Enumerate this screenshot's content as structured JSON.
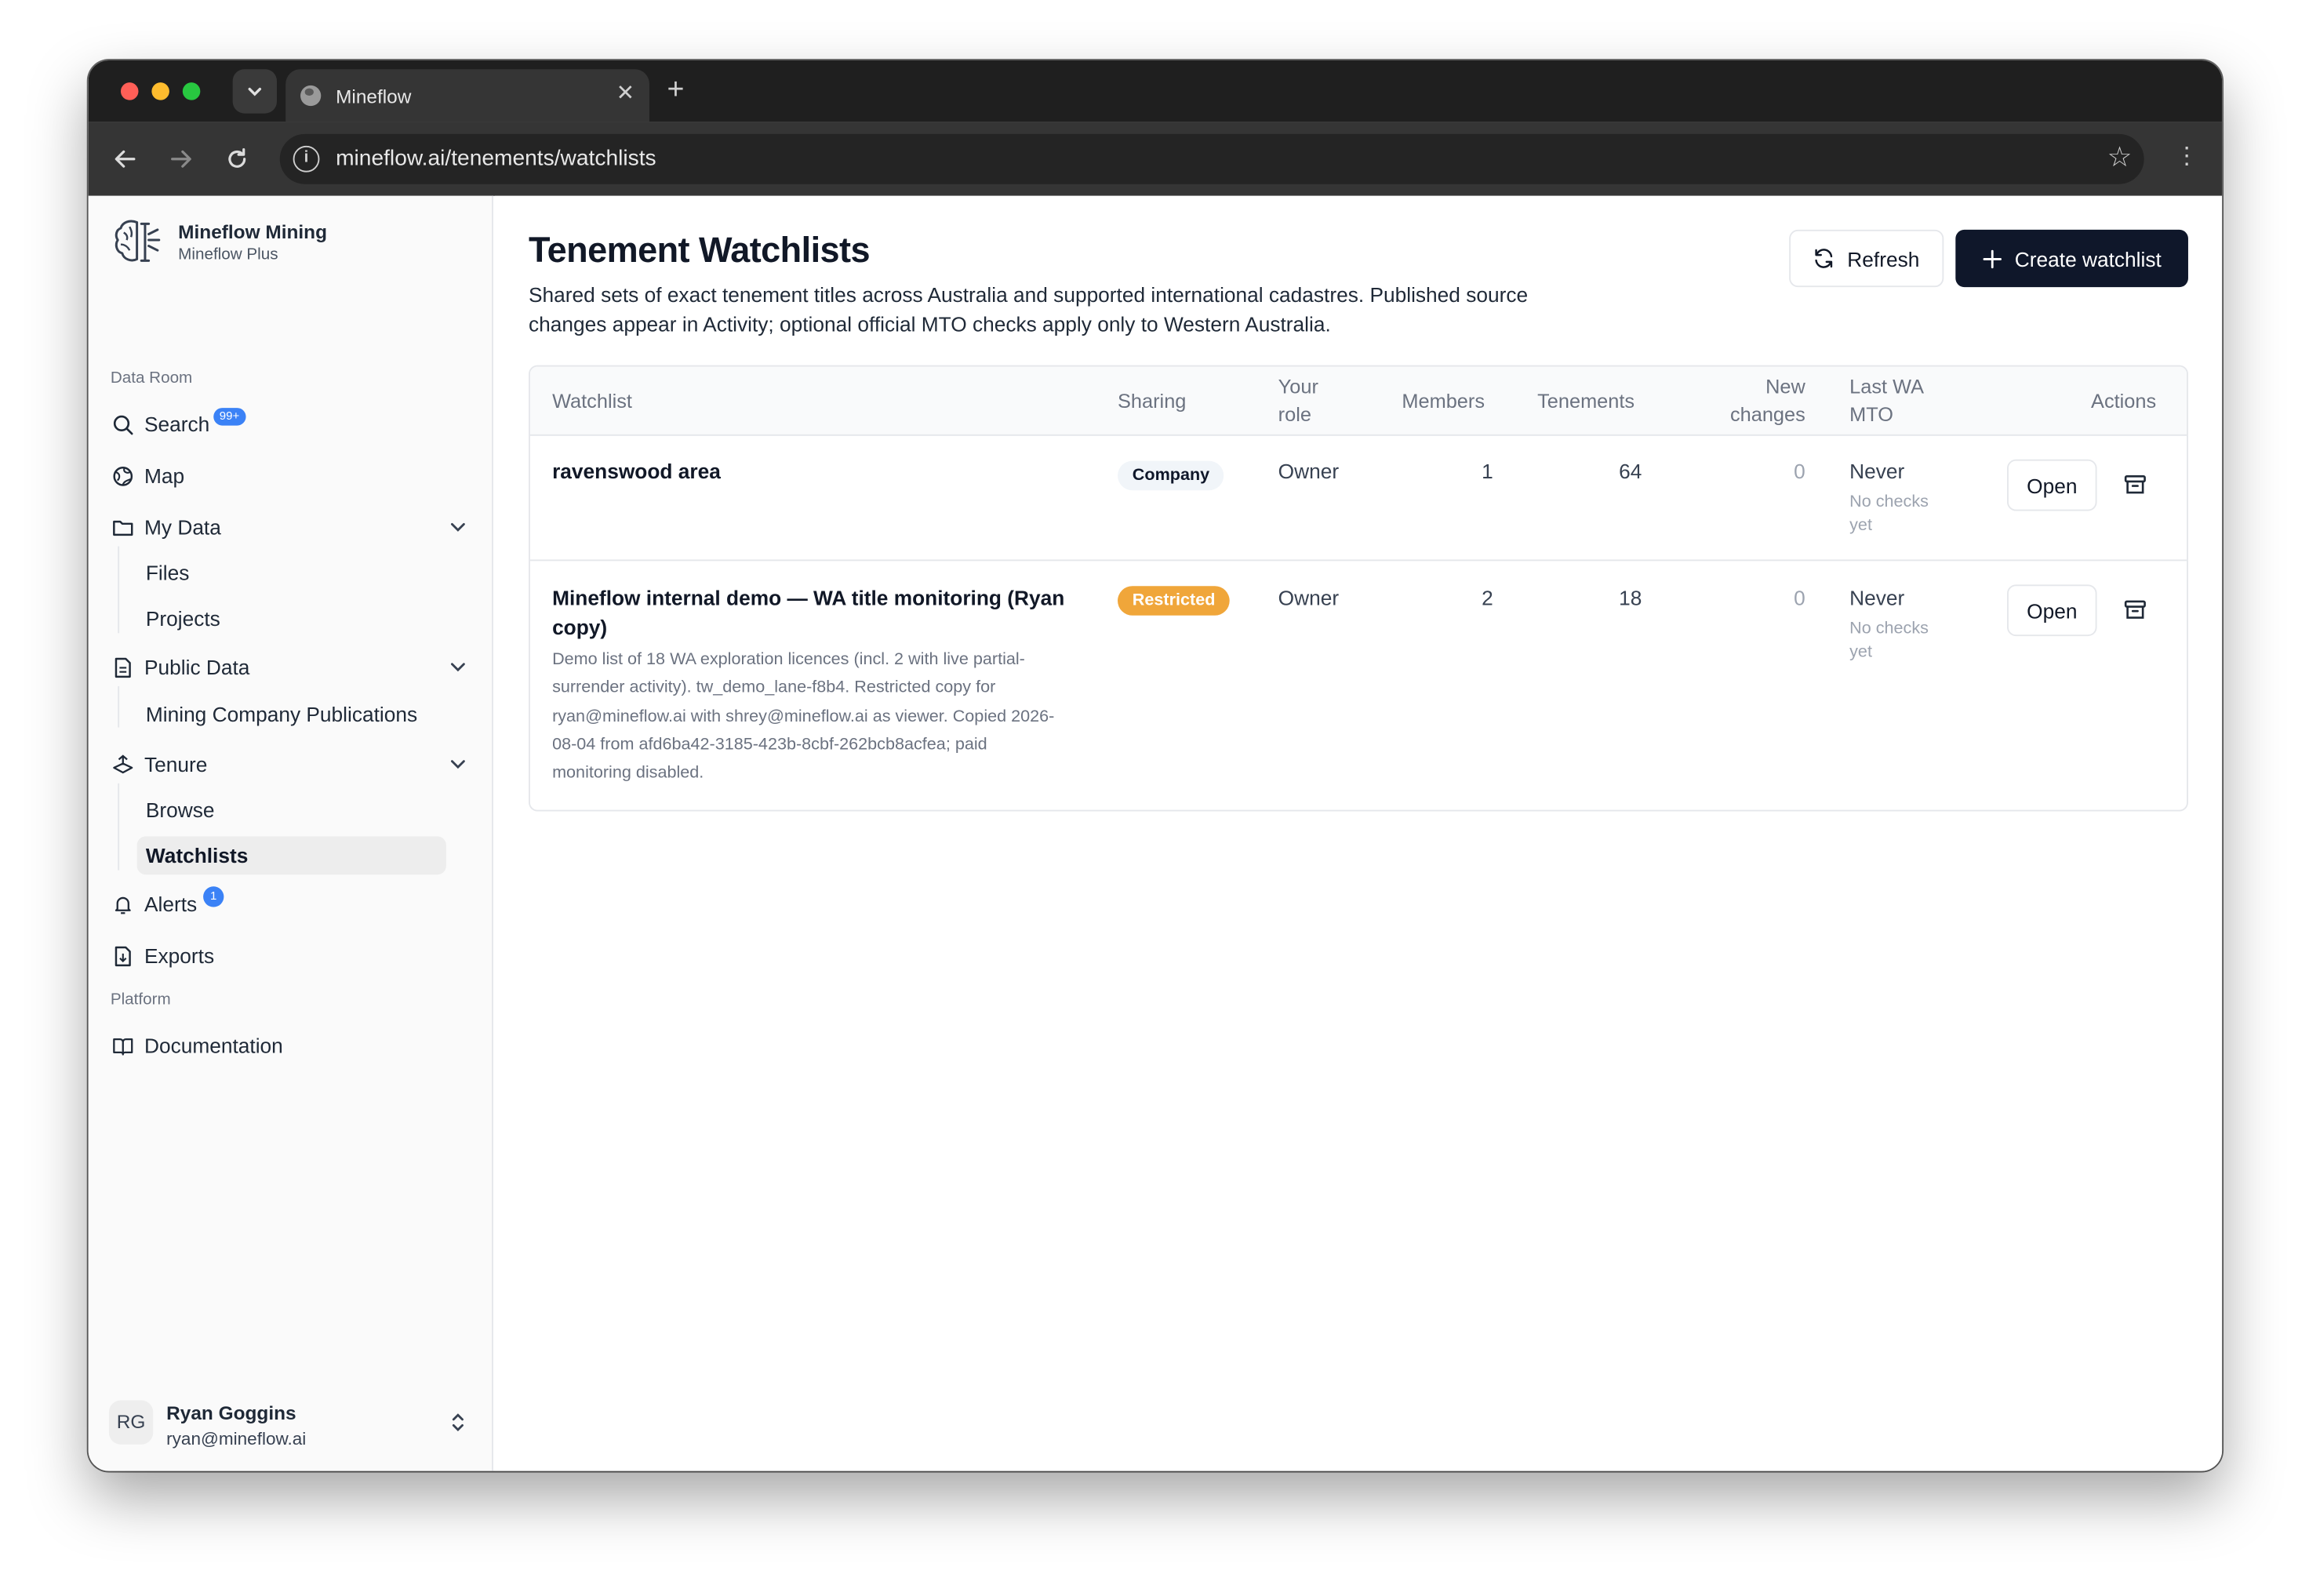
{
  "browser": {
    "tab_title": "Mineflow",
    "url": "mineflow.ai/tenements/watchlists"
  },
  "sidebar": {
    "org_name": "Mineflow Mining",
    "org_plan": "Mineflow Plus",
    "section_data_room": "Data Room",
    "search_label": "Search",
    "search_badge": "99+",
    "map_label": "Map",
    "my_data_label": "My Data",
    "my_data_items": [
      "Files",
      "Projects"
    ],
    "public_data_label": "Public Data",
    "public_data_items": [
      "Mining Company Publications"
    ],
    "tenure_label": "Tenure",
    "tenure_items": [
      "Browse",
      "Watchlists"
    ],
    "alerts_label": "Alerts",
    "alerts_badge": "1",
    "exports_label": "Exports",
    "section_platform": "Platform",
    "documentation_label": "Documentation",
    "user": {
      "initials": "RG",
      "name": "Ryan Goggins",
      "email": "ryan@mineflow.ai"
    }
  },
  "main": {
    "title": "Tenement Watchlists",
    "description": "Shared sets of exact tenement titles across Australia and supported international cadastres. Published source changes appear in Activity; optional official MTO checks apply only to Western Australia.",
    "refresh_label": "Refresh",
    "create_label": "Create watchlist",
    "table": {
      "headers": {
        "watchlist": "Watchlist",
        "sharing": "Sharing",
        "your_role": "Your role",
        "members": "Members",
        "tenements": "Tenements",
        "new_changes": "New changes",
        "last_wa_mto": "Last WA MTO",
        "actions": "Actions"
      },
      "rows": [
        {
          "name": "ravenswood area",
          "description": "",
          "sharing": "Company",
          "role": "Owner",
          "members": "1",
          "tenements": "64",
          "new_changes": "0",
          "last_mto": "Never",
          "last_mto_sub": "No checks yet",
          "open_label": "Open"
        },
        {
          "name": "Mineflow internal demo — WA title monitoring (Ryan copy)",
          "description": "Demo list of 18 WA exploration licences (incl. 2 with live partial-surrender activity). tw_demo_lane-f8b4. Restricted copy for ryan@mineflow.ai with shrey@mineflow.ai as viewer. Copied 2026-08-04 from afd6ba42-3185-423b-8cbf-262bcb8acfea; paid monitoring disabled.",
          "sharing": "Restricted",
          "role": "Owner",
          "members": "2",
          "tenements": "18",
          "new_changes": "0",
          "last_mto": "Never",
          "last_mto_sub": "No checks yet",
          "open_label": "Open"
        }
      ]
    }
  },
  "colors": {
    "primary_button": "#0f172a",
    "restricted_badge": "#f0a63a",
    "notification_badge": "#3b82f6",
    "active_nav_bg": "#ededed"
  },
  "icons": [
    "chevron-down-icon",
    "globe-icon",
    "close-icon",
    "plus-icon",
    "back-icon",
    "forward-icon",
    "reload-icon",
    "info-icon",
    "star-icon",
    "more-icon",
    "brain-logo-icon",
    "search-icon",
    "map-icon",
    "folder-icon",
    "document-icon",
    "tenure-icon",
    "bell-icon",
    "export-icon",
    "book-icon",
    "refresh-icon",
    "archive-icon",
    "chevrons-updown-icon"
  ]
}
